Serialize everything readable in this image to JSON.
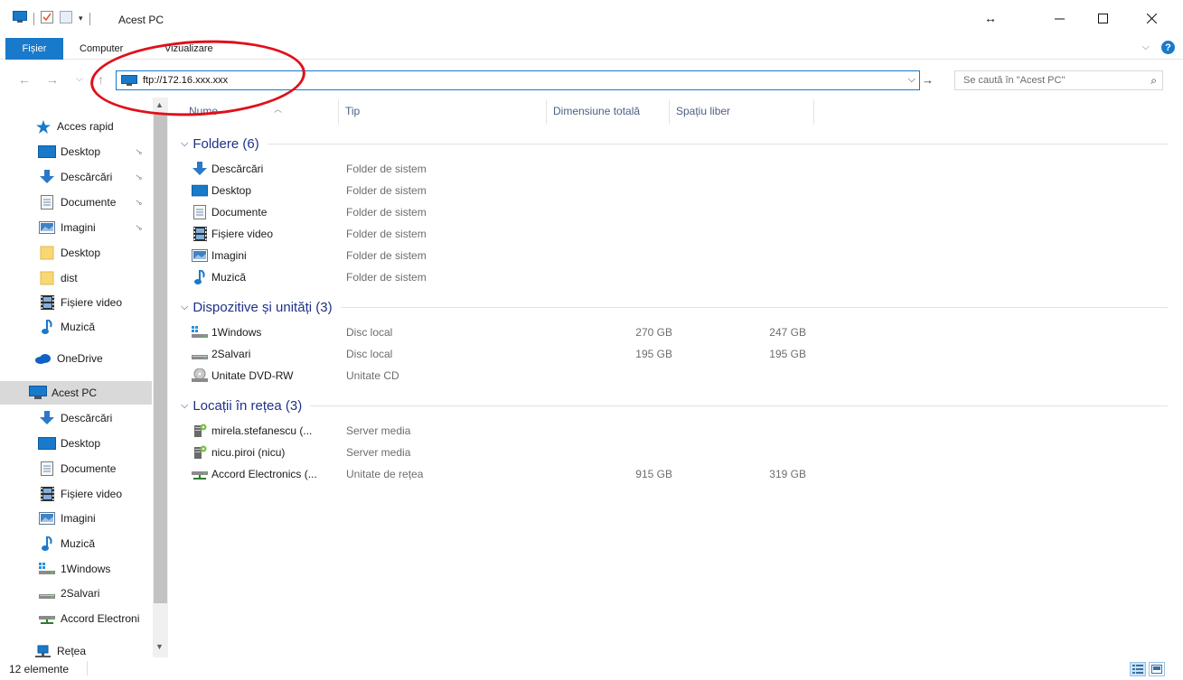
{
  "window": {
    "title": "Acest PC"
  },
  "ribbon": {
    "tabs": [
      "Fișier",
      "Computer",
      "Vizualizare"
    ]
  },
  "address": {
    "value": "ftp://172.16.xxx.xxx",
    "search_placeholder": "Se caută în \"Acest PC\""
  },
  "nav_pane": {
    "quick_access": "Acces rapid",
    "items": [
      {
        "label": "Acces rapid",
        "icon": "star-icon"
      },
      {
        "label": "Desktop",
        "icon": "desktop-icon",
        "pinned": true
      },
      {
        "label": "Descărcări",
        "icon": "download-icon",
        "pinned": true
      },
      {
        "label": "Documente",
        "icon": "document-icon",
        "pinned": true
      },
      {
        "label": "Imagini",
        "icon": "pictures-icon",
        "pinned": true
      },
      {
        "label": "Desktop",
        "icon": "folder-icon"
      },
      {
        "label": "dist",
        "icon": "folder-icon"
      },
      {
        "label": "Fișiere video",
        "icon": "video-icon"
      },
      {
        "label": "Muzică",
        "icon": "music-icon"
      },
      {
        "label": "OneDrive",
        "icon": "cloud-icon"
      },
      {
        "label": "Acest PC",
        "icon": "computer-icon",
        "selected": true
      },
      {
        "label": "Descărcări",
        "icon": "download-icon"
      },
      {
        "label": "Desktop",
        "icon": "desktop-icon"
      },
      {
        "label": "Documente",
        "icon": "document-icon"
      },
      {
        "label": "Fișiere video",
        "icon": "video-icon"
      },
      {
        "label": "Imagini",
        "icon": "pictures-icon"
      },
      {
        "label": "Muzică",
        "icon": "music-icon"
      },
      {
        "label": "1Windows",
        "icon": "windows-drive-icon"
      },
      {
        "label": "2Salvari",
        "icon": "drive-icon"
      },
      {
        "label": "Accord Electroni",
        "icon": "network-drive-icon"
      },
      {
        "label": "Rețea",
        "icon": "network-icon"
      }
    ]
  },
  "columns": {
    "name": "Nume",
    "type": "Tip",
    "total": "Dimensiune totală",
    "free": "Spațiu liber"
  },
  "groups": [
    {
      "title": "Foldere (6)",
      "rows": [
        {
          "name": "Descărcări",
          "type": "Folder de sistem",
          "total": "",
          "free": "",
          "icon": "download-icon"
        },
        {
          "name": "Desktop",
          "type": "Folder de sistem",
          "total": "",
          "free": "",
          "icon": "desktop-icon"
        },
        {
          "name": "Documente",
          "type": "Folder de sistem",
          "total": "",
          "free": "",
          "icon": "document-icon"
        },
        {
          "name": "Fișiere video",
          "type": "Folder de sistem",
          "total": "",
          "free": "",
          "icon": "video-icon"
        },
        {
          "name": "Imagini",
          "type": "Folder de sistem",
          "total": "",
          "free": "",
          "icon": "pictures-icon"
        },
        {
          "name": "Muzică",
          "type": "Folder de sistem",
          "total": "",
          "free": "",
          "icon": "music-icon"
        }
      ]
    },
    {
      "title": "Dispozitive și unități (3)",
      "rows": [
        {
          "name": "1Windows",
          "type": "Disc local",
          "total": "270 GB",
          "free": "247 GB",
          "icon": "windows-drive-icon"
        },
        {
          "name": "2Salvari",
          "type": "Disc local",
          "total": "195 GB",
          "free": "195 GB",
          "icon": "drive-icon"
        },
        {
          "name": "Unitate DVD-RW",
          "type": "Unitate CD",
          "total": "",
          "free": "",
          "icon": "dvd-icon"
        }
      ]
    },
    {
      "title": "Locații în rețea (3)",
      "rows": [
        {
          "name": "mirela.stefanescu (...",
          "type": "Server media",
          "total": "",
          "free": "",
          "icon": "media-server-icon"
        },
        {
          "name": "nicu.piroi (nicu)",
          "type": "Server media",
          "total": "",
          "free": "",
          "icon": "media-server-icon"
        },
        {
          "name": "Accord Electronics (...",
          "type": "Unitate de rețea",
          "total": "915 GB",
          "free": "319 GB",
          "icon": "network-drive-icon"
        }
      ]
    }
  ],
  "status": {
    "count": "12 elemente"
  },
  "colors": {
    "accent": "#1979ca",
    "group_header": "#1e3287",
    "annotation": "#e0101a"
  }
}
